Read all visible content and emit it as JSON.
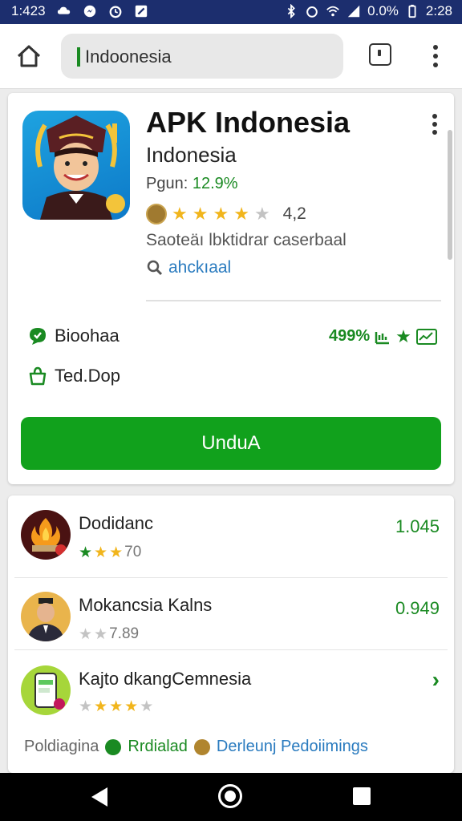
{
  "status_bar": {
    "time": "1:423",
    "battery": "0.0%",
    "clock_right": "2:28"
  },
  "browser": {
    "url": "Indoonesia"
  },
  "app": {
    "title": "APK Indonesia",
    "subtitle": "Indonesia",
    "rating_label": "Pgun:",
    "rating_value": "12.9%",
    "stars_filled": 4,
    "rating_number": "4,2",
    "description": "Saoteäı lbktidrar caserbaal",
    "search_link": "ahckıaal",
    "feature1_label": "Bioohaa",
    "feature1_value": "499%",
    "feature2_label": "Ted.Dop",
    "download_button": "UnduA"
  },
  "list": [
    {
      "title": "Dodidanc",
      "stars_filled": 3,
      "rating_text": "70",
      "value": "1.045"
    },
    {
      "title": "Mokancsia Kalns",
      "stars_filled": 2,
      "rating_text": "7.89",
      "value": "0.949"
    },
    {
      "title": "Kajto dkangCemnesia",
      "stars_filled": 3,
      "rating_text": "",
      "value": "›"
    }
  ],
  "footer": {
    "label1": "Poldiagina",
    "label2": "Rrdialad",
    "label3": "Derleunj Pedoiimings"
  },
  "colors": {
    "status_bar": "#1c2e6e",
    "accent_green": "#11a11c",
    "link_blue": "#2a7bbf",
    "star_gold": "#f1b51c"
  }
}
